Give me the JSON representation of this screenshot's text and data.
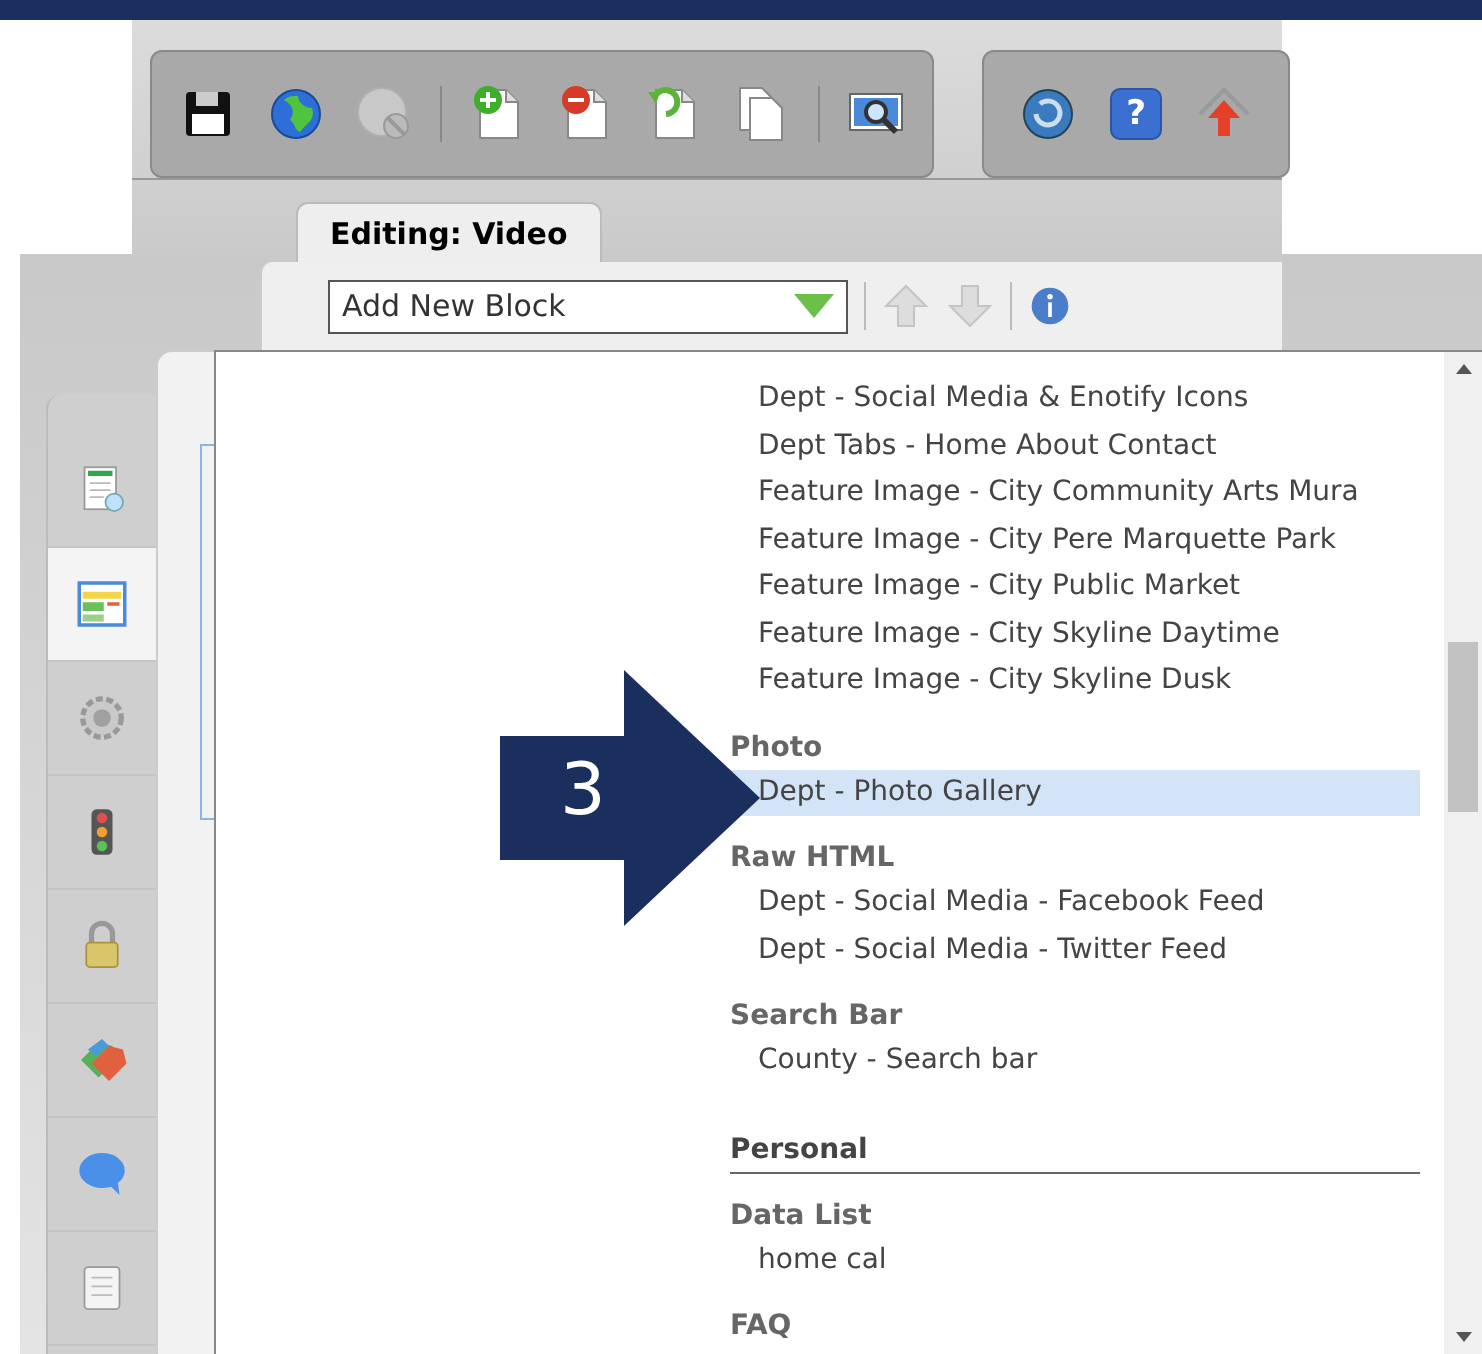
{
  "tab": {
    "label": "Editing: Video",
    "selected": true
  },
  "block_select": {
    "value": "Add New Block"
  },
  "sidebar": {
    "items": [
      {
        "selected": false
      },
      {
        "selected": true
      },
      {
        "selected": false
      },
      {
        "selected": false
      },
      {
        "selected": false
      },
      {
        "selected": false
      },
      {
        "selected": false
      },
      {
        "selected": false
      }
    ]
  },
  "annotation": {
    "label": "3"
  },
  "help_button": {
    "symbol": "?"
  },
  "list": {
    "entries": [
      {
        "kind": "item",
        "label": "Dept - Social Media & Enotify Icons",
        "selected": false
      },
      {
        "kind": "item",
        "label": "Dept Tabs - Home About Contact",
        "selected": false
      },
      {
        "kind": "item",
        "label": "Feature Image - City Community Arts Mura",
        "selected": false
      },
      {
        "kind": "item",
        "label": "Feature Image - City Pere Marquette Park",
        "selected": false
      },
      {
        "kind": "item",
        "label": "Feature Image - City Public Market",
        "selected": false
      },
      {
        "kind": "item",
        "label": "Feature Image - City Skyline Daytime",
        "selected": false
      },
      {
        "kind": "item",
        "label": "Feature Image - City Skyline Dusk",
        "selected": false
      },
      {
        "kind": "heading",
        "label": "Photo"
      },
      {
        "kind": "item",
        "label": "Dept - Photo Gallery",
        "selected": true
      },
      {
        "kind": "heading",
        "label": "Raw HTML"
      },
      {
        "kind": "item",
        "label": "Dept - Social Media - Facebook Feed",
        "selected": false
      },
      {
        "kind": "item",
        "label": "Dept - Social Media - Twitter Feed",
        "selected": false
      },
      {
        "kind": "heading",
        "label": "Search Bar"
      },
      {
        "kind": "item",
        "label": "County - Search bar",
        "selected": false
      },
      {
        "kind": "section",
        "label": "Personal"
      },
      {
        "kind": "heading",
        "label": "Data List"
      },
      {
        "kind": "item",
        "label": "home cal",
        "selected": false
      },
      {
        "kind": "heading",
        "label": "FAQ"
      }
    ]
  }
}
